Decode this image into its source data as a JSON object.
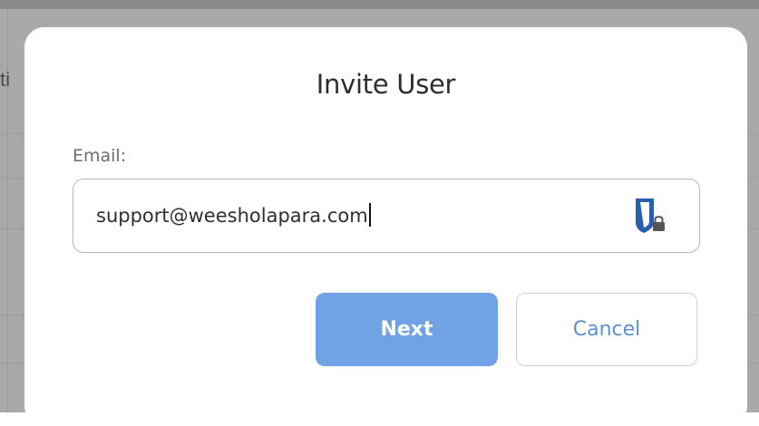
{
  "background": {
    "partial_text": "ti"
  },
  "dialog": {
    "title": "Invite User",
    "email_label": "Email:",
    "email_value": "support@weesholapara.com",
    "next_label": "Next",
    "cancel_label": "Cancel"
  },
  "icons": {
    "password_manager": "password-manager-shield-icon"
  },
  "colors": {
    "next_button": "#6fa3e6",
    "cancel_text": "#5b8fd8",
    "shield": "#2a5fb0"
  }
}
